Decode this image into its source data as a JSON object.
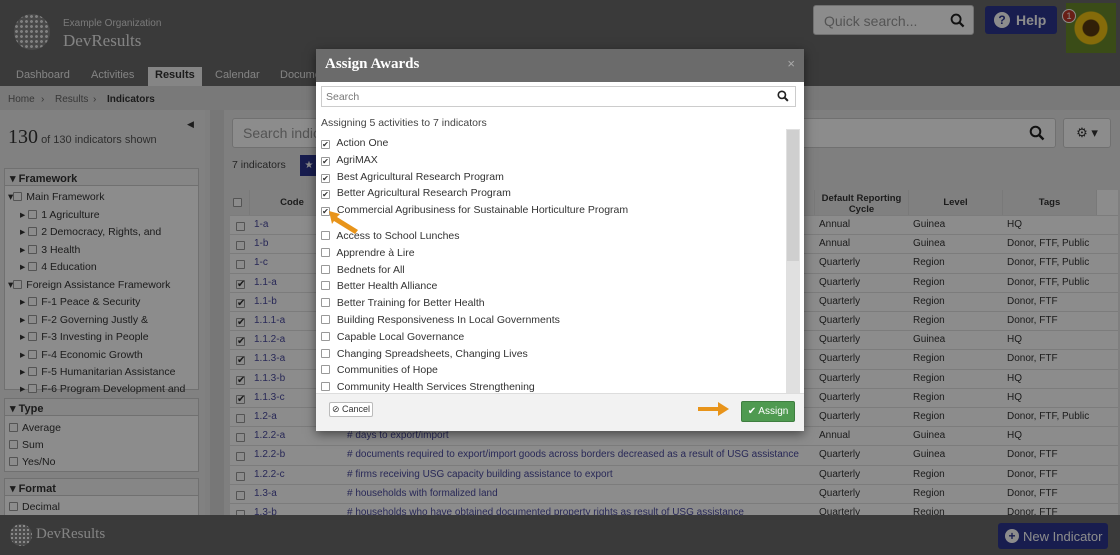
{
  "header": {
    "org": "Example Organization",
    "app": "DevResults",
    "quick_search_placeholder": "Quick search...",
    "help": "Help",
    "notifications": "1"
  },
  "nav": {
    "items": [
      "Dashboard",
      "Activities",
      "Results",
      "Calendar",
      "Docume"
    ],
    "active": "Results"
  },
  "breadcrumb": [
    "Home",
    "Results",
    "Indicators"
  ],
  "sidebar": {
    "count_big": "130",
    "count_text": "of 130 indicators shown",
    "framework_title": "Framework",
    "framework_items": [
      "Main Framework",
      "1 Agriculture",
      "2 Democracy, Rights, and",
      "3 Health",
      "4 Education",
      "Foreign Assistance Framework",
      "F-1 Peace & Security",
      "F-2 Governing Justly &",
      "F-3 Investing in People",
      "F-4 Economic Growth",
      "F-5 Humanitarian Assistance",
      "F-6 Program Development and"
    ],
    "type_title": "Type",
    "type_items": [
      "Average",
      "Sum",
      "Yes/No"
    ],
    "format_title": "Format",
    "format_items": [
      "Decimal"
    ]
  },
  "main": {
    "search_placeholder": "Search indic",
    "indicators_label": "7 indicators",
    "columns": [
      "Code",
      "Default Reporting Cycle",
      "Level",
      "Tags"
    ],
    "rows": [
      {
        "checked": false,
        "code": "1-a",
        "name": "",
        "cycle": "Annual",
        "level": "Guinea",
        "tags": "HQ"
      },
      {
        "checked": false,
        "code": "1-b",
        "name": "",
        "cycle": "Annual",
        "level": "Guinea",
        "tags": "Donor, FTF, Public"
      },
      {
        "checked": false,
        "code": "1-c",
        "name": "",
        "cycle": "Quarterly",
        "level": "Region",
        "tags": "Donor, FTF, Public"
      },
      {
        "checked": true,
        "code": "1.1-a",
        "name": "",
        "cycle": "Quarterly",
        "level": "Region",
        "tags": "Donor, FTF, Public"
      },
      {
        "checked": true,
        "code": "1.1-b",
        "name": "",
        "cycle": "Quarterly",
        "level": "Region",
        "tags": "Donor, FTF"
      },
      {
        "checked": true,
        "code": "1.1.1-a",
        "name": "",
        "cycle": "Quarterly",
        "level": "Region",
        "tags": "Donor, FTF"
      },
      {
        "checked": true,
        "code": "1.1.2-a",
        "name": "",
        "cycle": "Quarterly",
        "level": "Guinea",
        "tags": "HQ"
      },
      {
        "checked": true,
        "code": "1.1.3-a",
        "name": "",
        "cycle": "Quarterly",
        "level": "Region",
        "tags": "Donor, FTF"
      },
      {
        "checked": true,
        "code": "1.1.3-b",
        "name": "",
        "cycle": "Quarterly",
        "level": "Region",
        "tags": "HQ"
      },
      {
        "checked": true,
        "code": "1.1.3-c",
        "name": "",
        "cycle": "Quarterly",
        "level": "Region",
        "tags": "HQ"
      },
      {
        "checked": false,
        "code": "1.2-a",
        "name": "",
        "cycle": "Quarterly",
        "level": "Region",
        "tags": "Donor, FTF, Public"
      },
      {
        "checked": false,
        "code": "1.2.2-a",
        "name": "# days to export/import",
        "cycle": "Annual",
        "level": "Guinea",
        "tags": "HQ"
      },
      {
        "checked": false,
        "code": "1.2.2-b",
        "name": "# documents required to export/import goods across borders decreased as a result of USG assistance",
        "cycle": "Quarterly",
        "level": "Guinea",
        "tags": "Donor, FTF"
      },
      {
        "checked": false,
        "code": "1.2.2-c",
        "name": "# firms receiving USG capacity building assistance to export",
        "cycle": "Quarterly",
        "level": "Region",
        "tags": "Donor, FTF"
      },
      {
        "checked": false,
        "code": "1.3-a",
        "name": "# households with formalized land",
        "cycle": "Quarterly",
        "level": "Region",
        "tags": "Donor, FTF"
      },
      {
        "checked": false,
        "code": "1.3-b",
        "name": "# households who have obtained documented property rights as result of USG assistance",
        "cycle": "Quarterly",
        "level": "Region",
        "tags": "Donor, FTF"
      }
    ]
  },
  "footer": {
    "app": "DevResults",
    "new_indicator": "New Indicator"
  },
  "modal": {
    "title": "Assign Awards",
    "close": "×",
    "search_placeholder": "Search",
    "assigning_text": "Assigning 5 activities to 7 indicators",
    "activities": [
      {
        "label": "Action One",
        "checked": true
      },
      {
        "label": "AgriMAX",
        "checked": true
      },
      {
        "label": "Best Agricultural Research Program",
        "checked": true
      },
      {
        "label": "Better Agricultural Research Program",
        "checked": true
      },
      {
        "label": "Commercial Agribusiness for Sustainable Horticulture Program",
        "checked": true
      },
      {
        "label": "Access to School Lunches",
        "checked": false
      },
      {
        "label": "Apprendre à Lire",
        "checked": false
      },
      {
        "label": "Bednets for All",
        "checked": false
      },
      {
        "label": "Better Health Alliance",
        "checked": false
      },
      {
        "label": "Better Training for Better Health",
        "checked": false
      },
      {
        "label": "Building Responsiveness In Local Governments",
        "checked": false
      },
      {
        "label": "Capable Local Governance",
        "checked": false
      },
      {
        "label": "Changing Spreadsheets, Changing Lives",
        "checked": false
      },
      {
        "label": "Communities of Hope",
        "checked": false
      },
      {
        "label": "Community Health Services Strengthening",
        "checked": false
      }
    ],
    "cancel": "Cancel",
    "assign": "Assign"
  },
  "colors": {
    "brand": "#2d3691",
    "assign": "#4f9a50",
    "header": "#6b6b6b",
    "highlight": "#e8941a"
  }
}
